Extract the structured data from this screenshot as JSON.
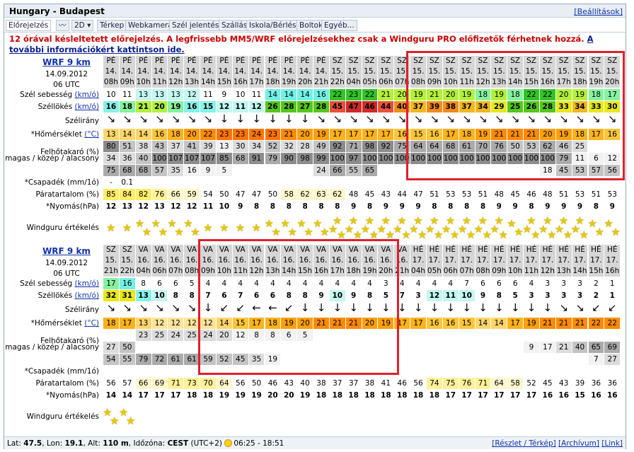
{
  "title": "Hungary - Budapest",
  "settings_label": "[Beállítások]",
  "tabs": [
    "Előrejelzés",
    "〰",
    "2D ▾",
    "Térkep",
    "Webkamera",
    "Szél jelentés",
    "Szállás",
    "Iskola/Bérlés",
    "Boltok",
    "Egyéb..."
  ],
  "notice": {
    "text": "12 órával késleltetett előrejelzés. A legfrissebb MM5/WRF előrejelzésekhez csak a Windguru PRO előfizetők férhetnek hozzá.",
    "link": "A további információkért kattintson ide."
  },
  "labels": {
    "wind_speed": "Szél sebesség",
    "gust": "Széllökés",
    "unit_kmh": "(km/ó)",
    "direction": "Szélirány",
    "temp": "*Hőmérséklet",
    "unit_c": "(°C)",
    "cloud1": "Felhőtakaró (%)",
    "cloud2": "magas / közép / alacsony",
    "precip": "*Csapadék (mm/1ó)",
    "humidity": "Páratartalom (%)",
    "pressure": "*Nyomás(hPa)",
    "rating": "Windguru értékelés"
  },
  "model": {
    "name": "WRF 9 km",
    "date": "14.09.2012",
    "run": "06 UTC"
  },
  "colors": {
    "accent": "#1133aa",
    "notice": "#cc0000",
    "highlight_box": "#e0202c"
  },
  "block1": {
    "days": [
      "PÉ",
      "PÉ",
      "PÉ",
      "PÉ",
      "PÉ",
      "PÉ",
      "PÉ",
      "PÉ",
      "PÉ",
      "PÉ",
      "PÉ",
      "PÉ",
      "PÉ",
      "PÉ",
      "SZ",
      "SZ",
      "SZ",
      "SZ",
      "SZ",
      "SZ",
      "SZ",
      "SZ",
      "SZ",
      "SZ",
      "SZ",
      "SZ",
      "SZ",
      "SZ",
      "SZ",
      "SZ",
      "SZ",
      "SZ"
    ],
    "dates": [
      "14.",
      "14.",
      "14.",
      "14.",
      "14.",
      "14.",
      "14.",
      "14.",
      "14.",
      "14.",
      "14.",
      "14.",
      "14.",
      "14.",
      "15.",
      "15.",
      "15.",
      "15.",
      "15.",
      "15.",
      "15.",
      "15.",
      "15.",
      "15.",
      "15.",
      "15.",
      "15.",
      "15.",
      "15.",
      "15.",
      "15.",
      "15."
    ],
    "hours": [
      "08h",
      "09h",
      "10h",
      "11h",
      "12h",
      "13h",
      "14h",
      "15h",
      "16h",
      "17h",
      "18h",
      "19h",
      "20h",
      "21h",
      "22h",
      "04h",
      "05h",
      "06h",
      "07h",
      "08h",
      "09h",
      "10h",
      "11h",
      "12h",
      "13h",
      "14h",
      "15h",
      "16h",
      "17h",
      "18h",
      "19h",
      "20h"
    ],
    "wind": [
      "10",
      "11",
      "13",
      "13",
      "13",
      "12",
      "11",
      "9",
      "10",
      "11",
      "14",
      "14",
      "14",
      "16",
      "22",
      "23",
      "22",
      "21",
      "20",
      "19",
      "21",
      "20",
      "19",
      "18",
      "19",
      "18",
      "22",
      "22",
      "20",
      "19",
      "18",
      "17"
    ],
    "gust": [
      "16",
      "18",
      "21",
      "20",
      "19",
      "16",
      "15",
      "12",
      "11",
      "12",
      "26",
      "28",
      "27",
      "28",
      "45",
      "47",
      "46",
      "44",
      "40",
      "37",
      "39",
      "38",
      "37",
      "34",
      "29",
      "25",
      "26",
      "28",
      "33",
      "34",
      "33",
      "30"
    ],
    "dir": [
      "↘",
      "↘",
      "↘",
      "↘",
      "↘",
      "↘",
      "↘",
      "↓",
      "↓",
      "↓",
      "↓",
      "↓",
      "↓",
      "↘",
      "↘",
      "↘",
      "↘",
      "↘",
      "↘",
      "↘",
      "↘",
      "↘",
      "↘",
      "↘",
      "↘",
      "↘",
      "↘",
      "↘",
      "↘",
      "↘",
      "↘",
      "↘"
    ],
    "temp": [
      "13",
      "14",
      "14",
      "16",
      "18",
      "20",
      "22",
      "23",
      "23",
      "24",
      "23",
      "21",
      "20",
      "19",
      "17",
      "17",
      "17",
      "17",
      "16",
      "15",
      "16",
      "17",
      "18",
      "19",
      "21",
      "21",
      "21",
      "20",
      "19",
      "18",
      "17",
      "16"
    ],
    "cloud_high": [
      "80",
      "51",
      "38",
      "43",
      "37",
      "41",
      "39",
      "13",
      "30",
      "34",
      "52",
      "32",
      "28",
      "49",
      "92",
      "71",
      "98",
      "92",
      "75",
      "64",
      "64",
      "68",
      "61",
      "70",
      "76",
      "50",
      "53",
      "62",
      "46",
      "25",
      "",
      ""
    ],
    "cloud_mid": [
      "34",
      "36",
      "40",
      "100",
      "107",
      "107",
      "107",
      "85",
      "68",
      "91",
      "79",
      "90",
      "98",
      "99",
      "100",
      "97",
      "100",
      "100",
      "100",
      "100",
      "100",
      "100",
      "100",
      "100",
      "100",
      "100",
      "100",
      "100",
      "79",
      "11",
      "6",
      "12"
    ],
    "cloud_low": [
      "75",
      "68",
      "68",
      "57",
      "35",
      "16",
      "9",
      "5",
      "",
      "",
      "",
      "",
      "",
      "24",
      "66",
      "55",
      "65",
      "",
      "",
      "",
      "",
      "",
      "",
      "",
      "",
      "",
      "",
      "18",
      "45",
      "53",
      "57",
      "56"
    ],
    "precip": [
      "-",
      "0.1",
      "",
      "",
      "",
      "",
      "",
      "",
      "",
      "",
      "",
      "",
      "",
      "",
      "",
      "",
      "",
      "",
      "",
      "",
      "",
      "",
      "",
      "",
      "",
      "",
      "",
      "",
      "",
      "",
      "",
      ""
    ],
    "humidity": [
      "85",
      "84",
      "82",
      "76",
      "66",
      "59",
      "54",
      "50",
      "47",
      "47",
      "50",
      "58",
      "62",
      "63",
      "62",
      "48",
      "45",
      "43",
      "44",
      "47",
      "51",
      "53",
      "53",
      "51",
      "48",
      "45",
      "46",
      "48",
      "51",
      "53",
      "51",
      "53"
    ],
    "pressure": [
      "12",
      "13",
      "12",
      "13",
      "12",
      "12",
      "11",
      "10",
      "9",
      "8",
      "8",
      "8",
      "8",
      "8",
      "8",
      "9",
      "8",
      "9",
      "9",
      "9",
      "8",
      "8",
      "8",
      "8",
      "9",
      "9",
      "8",
      "9",
      "9",
      "9",
      "8",
      "9"
    ],
    "rating": [
      1,
      1,
      2,
      2,
      2,
      2,
      1,
      1,
      1,
      1,
      2,
      2,
      2,
      2,
      3,
      3,
      3,
      3,
      3,
      3,
      3,
      3,
      3,
      3,
      3,
      2,
      3,
      3,
      3,
      3,
      2,
      2
    ]
  },
  "block2": {
    "days": [
      "SZ",
      "SZ",
      "VA",
      "VA",
      "VA",
      "VA",
      "VA",
      "VA",
      "VA",
      "VA",
      "VA",
      "VA",
      "VA",
      "VA",
      "VA",
      "VA",
      "VA",
      "VA",
      "VA",
      "HÉ",
      "HÉ",
      "HÉ",
      "HÉ",
      "HÉ",
      "HÉ",
      "HÉ",
      "HÉ",
      "HÉ",
      "HÉ",
      "HÉ",
      "HÉ",
      "HÉ"
    ],
    "dates": [
      "15.",
      "15.",
      "16.",
      "16.",
      "16.",
      "16.",
      "16.",
      "16.",
      "16.",
      "16.",
      "16.",
      "16.",
      "16.",
      "16.",
      "16.",
      "16.",
      "16.",
      "16.",
      "16.",
      "17.",
      "17.",
      "17.",
      "17.",
      "17.",
      "17.",
      "17.",
      "17.",
      "17.",
      "17.",
      "17.",
      "17.",
      "17."
    ],
    "hours": [
      "21h",
      "22h",
      "04h",
      "06h",
      "07h",
      "08h",
      "09h",
      "10h",
      "11h",
      "12h",
      "13h",
      "14h",
      "15h",
      "16h",
      "17h",
      "18h",
      "19h",
      "20h",
      "21h",
      "04h",
      "05h",
      "06h",
      "07h",
      "08h",
      "09h",
      "10h",
      "11h",
      "12h",
      "13h",
      "14h",
      "15h",
      "16h"
    ],
    "wind": [
      "17",
      "16",
      "8",
      "6",
      "6",
      "5",
      "4",
      "4",
      "4",
      "4",
      "4",
      "4",
      "4",
      "4",
      "4",
      "4",
      "4",
      "3",
      "4",
      "4",
      "4",
      "4",
      "7",
      "6",
      "6",
      "6",
      "4",
      "3",
      "3",
      "3",
      "2",
      "1"
    ],
    "gust": [
      "32",
      "31",
      "13",
      "10",
      "8",
      "8",
      "7",
      "6",
      "7",
      "6",
      "6",
      "8",
      "8",
      "9",
      "10",
      "9",
      "8",
      "5",
      "7",
      "3",
      "12",
      "11",
      "10",
      "9",
      "8",
      "5",
      "3",
      "3",
      "3",
      "3",
      "2",
      "1"
    ],
    "dir": [
      "↘",
      "↘",
      "↘",
      "↘",
      "↘",
      "↘",
      "↓",
      "↙",
      "↙",
      "←",
      "←",
      "↙",
      "↓",
      "↓",
      "↓",
      "↓",
      "↓",
      "↓",
      "↓",
      "↓",
      "↓",
      "↓",
      "↓",
      "↓",
      "↓",
      "↓",
      "↓",
      "↓",
      "↘",
      "↘",
      "↙",
      "↙"
    ],
    "temp": [
      "18",
      "17",
      "13",
      "12",
      "12",
      "12",
      "12",
      "14",
      "15",
      "17",
      "18",
      "19",
      "20",
      "21",
      "21",
      "21",
      "20",
      "19",
      "17",
      "17",
      "16",
      "16",
      "15",
      "14",
      "14",
      "17",
      "19",
      "21",
      "21",
      "21",
      "22",
      "22"
    ],
    "cloud_high": [
      "",
      "",
      "23",
      "25",
      "24",
      "25",
      "24",
      "20",
      "12",
      "8",
      "8",
      "6",
      "5",
      "",
      "",
      "",
      "",
      "",
      "",
      "",
      "",
      "",
      "",
      "",
      "",
      "",
      "",
      "",
      "",
      "",
      "",
      ""
    ],
    "cloud_mid": [
      "27",
      "50",
      "",
      "",
      "",
      "",
      "",
      "",
      "",
      "",
      "",
      "",
      "",
      "",
      "",
      "",
      "",
      "",
      "",
      "",
      "",
      "",
      "",
      "",
      "",
      "",
      "9",
      "17",
      "21",
      "40",
      "65",
      "69"
    ],
    "cloud_low": [
      "54",
      "55",
      "79",
      "72",
      "61",
      "61",
      "59",
      "52",
      "45",
      "35",
      "19",
      "",
      "",
      "",
      "",
      "",
      "",
      "",
      "",
      "",
      "",
      "",
      "",
      "",
      "",
      "",
      "",
      "",
      "",
      "",
      "7",
      "27"
    ],
    "precip": [
      "",
      "",
      "",
      "",
      "",
      "",
      "",
      "",
      "",
      "",
      "",
      "",
      "",
      "",
      "",
      "",
      "",
      "",
      "",
      "",
      "",
      "",
      "",
      "",
      "",
      "",
      "",
      "",
      "",
      "",
      "",
      ""
    ],
    "humidity": [
      "56",
      "57",
      "66",
      "69",
      "71",
      "73",
      "70",
      "64",
      "56",
      "50",
      "46",
      "43",
      "40",
      "38",
      "37",
      "37",
      "38",
      "41",
      "46",
      "56",
      "74",
      "75",
      "76",
      "71",
      "64",
      "58",
      "52",
      "45",
      "43",
      "39",
      "36",
      "36"
    ],
    "pressure": [
      "14",
      "14",
      "17",
      "17",
      "17",
      "18",
      "18",
      "19",
      "19",
      "19",
      "20",
      "20",
      "19",
      "18",
      "18",
      "18",
      "18",
      "18",
      "18",
      "18",
      "18",
      "17",
      "17",
      "17",
      "17",
      "17",
      "17",
      "16",
      "16",
      "15",
      "16",
      "16"
    ],
    "rating": [
      2,
      2,
      0,
      0,
      0,
      0,
      0,
      0,
      0,
      0,
      0,
      0,
      0,
      0,
      0,
      0,
      0,
      0,
      0,
      0,
      0,
      0,
      0,
      0,
      0,
      0,
      0,
      0,
      0,
      0,
      0,
      0
    ]
  },
  "footer": {
    "lat_label": "Lat:",
    "lat": "47.5",
    "lon_label": "Lon:",
    "lon": "19.1",
    "alt_label": "Alt:",
    "alt": "110 m",
    "tz_label": "Időzóna:",
    "tz": "CEST",
    "tz_offset": "(UTC+2)",
    "sun": "06:25 - 18:51",
    "links": [
      "[Részlet / Térkép]",
      "[Archívum]",
      "[Link]"
    ]
  }
}
